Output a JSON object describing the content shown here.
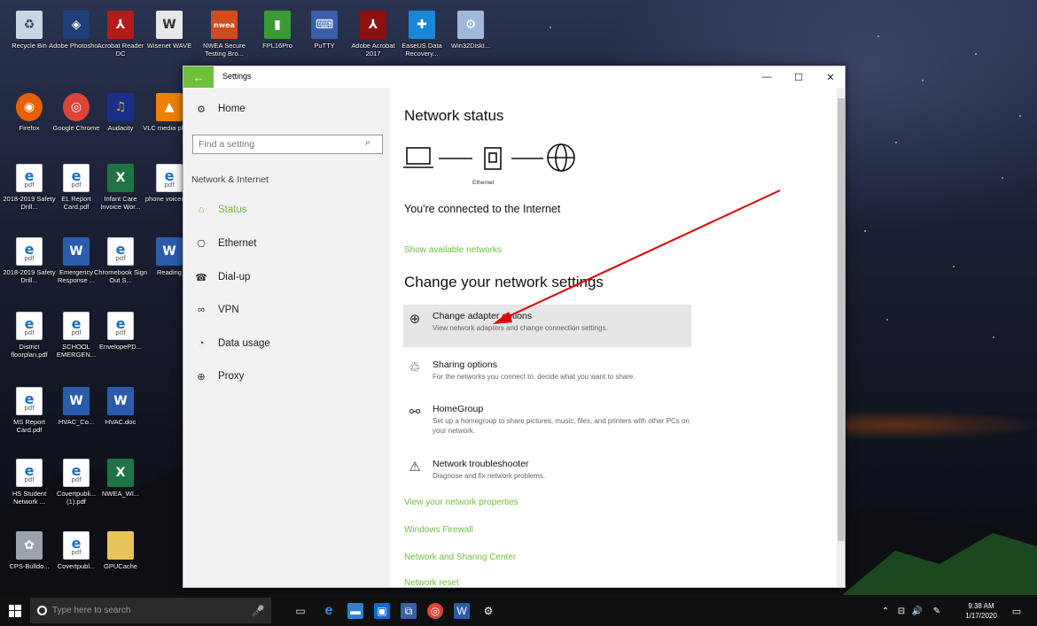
{
  "desktop_icons": {
    "recycle": "Recycle Bin",
    "photoshop": "Adobe Photosho...",
    "acrobat_dc": "Acrobat Reader DC",
    "wisenet": "Wisenet WAVE",
    "nwea": "NWEA Secure Testing Bro...",
    "fpl16pro": "FPL16Pro",
    "putty": "PuTTY",
    "acrobat2017": "Adobe Acrobat 2017",
    "easeus": "EaseUS Data Recovery...",
    "win32disk": "Win32DiskI...",
    "firefox": "Firefox",
    "chrome": "Google Chrome",
    "audacity": "Audacity",
    "vlc": "VLC media player",
    "safety1": "2018-2019 Safety Drill...",
    "elreport": "EL Report Card.pdf",
    "infantcare": "Infant Care Invoice Wor...",
    "phone": "phone voicemail",
    "safety2": "2018-2019 Safety Drill...",
    "emergency": "Emergency Response ...",
    "chromebook": "Chromebook Sign Out S...",
    "reading": "Reading",
    "district": "District floorplan.pdf",
    "school": "SCHOOL EMERGEN...",
    "envelope": "EnvelopePD...",
    "msreport": "MS Report Card.pdf",
    "hvac_co": "HVAC_Co...",
    "hvac_doc": "HVAC.doc",
    "hsstudent": "HS Student Network ...",
    "covert1": "Covertpubli... (1).pdf",
    "nwea_wi": "NWEA_WI...",
    "cpsbull": "CPS-Bulldo...",
    "covert2": "Covertpubl...",
    "gpucache": "GPUCache"
  },
  "window": {
    "title": "Settings",
    "back_glyph": "←",
    "minimize": "—",
    "maximize": "☐",
    "close": "✕"
  },
  "sidebar": {
    "home": "Home",
    "search_placeholder": "Find a setting",
    "section": "Network & Internet",
    "items": [
      {
        "label": "Status",
        "active": true
      },
      {
        "label": "Ethernet"
      },
      {
        "label": "Dial-up"
      },
      {
        "label": "VPN"
      },
      {
        "label": "Data usage"
      },
      {
        "label": "Proxy"
      }
    ]
  },
  "main": {
    "title": "Network status",
    "ethernet_caption": "Ethernet",
    "connected": "You're connected to the Internet",
    "show_networks": "Show available networks",
    "change_heading": "Change your network settings",
    "options": [
      {
        "title": "Change adapter options",
        "desc": "View network adapters and change connection settings."
      },
      {
        "title": "Sharing options",
        "desc": "For the networks you connect to, decide what you want to share."
      },
      {
        "title": "HomeGroup",
        "desc": "Set up a homegroup to share pictures, music, files, and printers with other PCs on your network."
      },
      {
        "title": "Network troubleshooter",
        "desc": "Diagnose and fix network problems."
      }
    ],
    "links": [
      "View your network properties",
      "Windows Firewall",
      "Network and Sharing Center",
      "Network reset"
    ]
  },
  "taskbar": {
    "search_placeholder": "Type here to search",
    "time": "9:38 AM",
    "date": "1/17/2020"
  },
  "colors": {
    "accent": "#6fbf3b",
    "annotation_arrow": "#e00000"
  }
}
